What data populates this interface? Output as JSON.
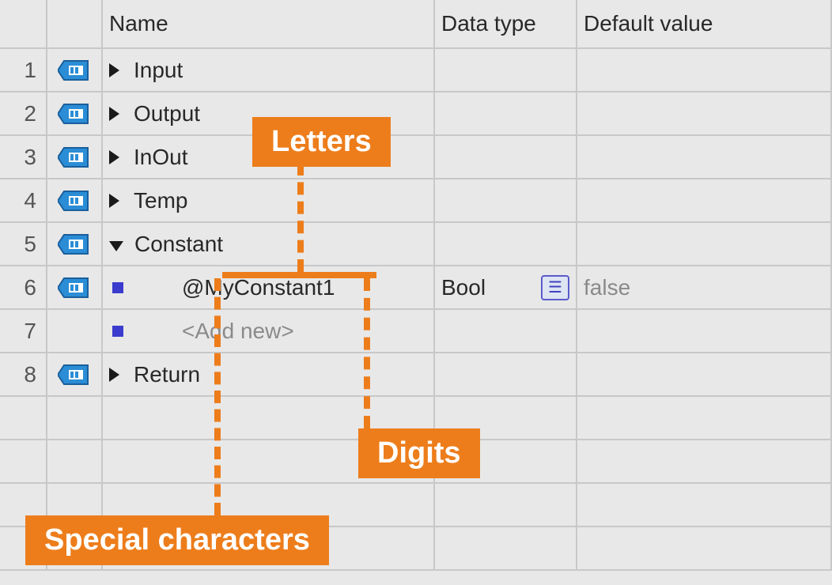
{
  "headers": {
    "name": "Name",
    "datatype": "Data type",
    "default": "Default value"
  },
  "rows": [
    {
      "num": "1",
      "name": "Input",
      "expand": "right",
      "hasTag": true
    },
    {
      "num": "2",
      "name": "Output",
      "expand": "right",
      "hasTag": true
    },
    {
      "num": "3",
      "name": "InOut",
      "expand": "right",
      "hasTag": true
    },
    {
      "num": "4",
      "name": "Temp",
      "expand": "right",
      "hasTag": true
    },
    {
      "num": "5",
      "name": "Constant",
      "expand": "down",
      "hasTag": true
    },
    {
      "num": "6",
      "name": "@MyConstant1",
      "bullet": true,
      "indent": true,
      "hasTag": true,
      "datatype": "Bool",
      "default": "false",
      "typeIcon": true
    },
    {
      "num": "7",
      "name": "<Add new>",
      "bullet": true,
      "indent": true,
      "hasTag": false,
      "ghost": true
    },
    {
      "num": "8",
      "name": "Return",
      "expand": "right",
      "hasTag": true
    }
  ],
  "annotations": {
    "letters": "Letters",
    "digits": "Digits",
    "special": "Special characters"
  }
}
